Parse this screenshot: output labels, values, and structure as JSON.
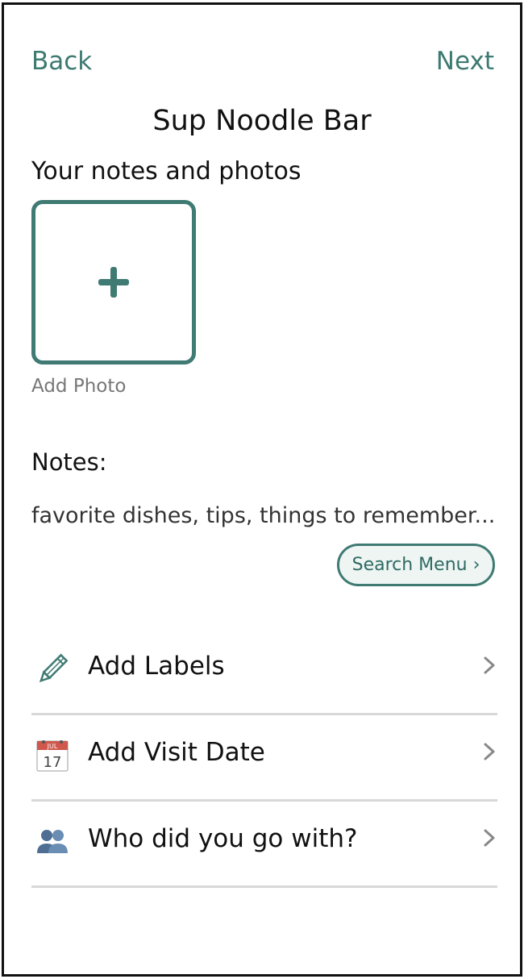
{
  "header": {
    "back_label": "Back",
    "next_label": "Next",
    "title": "Sup Noodle Bar"
  },
  "photos": {
    "heading": "Your notes and photos",
    "add_photo_label": "Add Photo",
    "add_icon": "plus-icon"
  },
  "notes": {
    "label": "Notes:",
    "placeholder": "favorite dishes, tips, things to remember...",
    "value": "",
    "search_menu_label": "Search Menu ›"
  },
  "rows": [
    {
      "label": "Add Labels",
      "icon": "pencil-icon"
    },
    {
      "label": "Add Visit Date",
      "icon": "calendar-icon",
      "calendar_month": "JUL",
      "calendar_day": "17"
    },
    {
      "label": "Who did you go with?",
      "icon": "people-icon"
    }
  ],
  "colors": {
    "accent": "#3f7a73",
    "accent_light": "#eef5f3",
    "divider": "#d8d8d8",
    "muted_text": "#777777",
    "chevron": "#888888"
  }
}
